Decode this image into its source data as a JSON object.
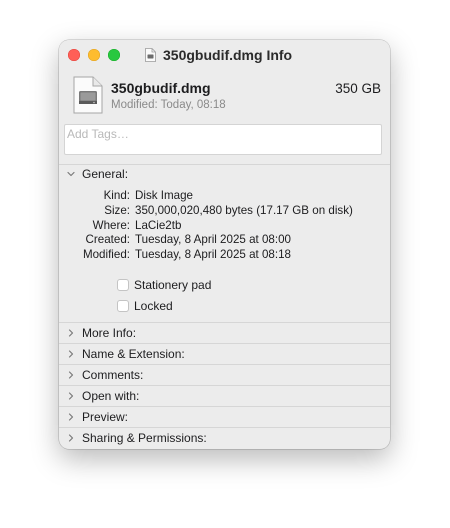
{
  "window": {
    "title": "350gbudif.dmg Info"
  },
  "summary": {
    "file_name": "350gbudif.dmg",
    "size": "350 GB",
    "modified": "Modified: Today, 08:18"
  },
  "tags": {
    "placeholder": "Add Tags…",
    "value": ""
  },
  "general": {
    "header": "General:",
    "rows": [
      {
        "key": "Kind:",
        "value": "Disk Image"
      },
      {
        "key": "Size:",
        "value": "350,000,020,480 bytes (17.17 GB on disk)"
      },
      {
        "key": "Where:",
        "value": "LaCie2tb"
      },
      {
        "key": "Created:",
        "value": "Tuesday, 8 April 2025 at 08:00"
      },
      {
        "key": "Modified:",
        "value": "Tuesday, 8 April 2025 at 08:18"
      }
    ],
    "stationery_label": "Stationery pad",
    "stationery_checked": false,
    "locked_label": "Locked",
    "locked_checked": false
  },
  "sections": [
    {
      "label": "More Info:",
      "expanded": false
    },
    {
      "label": "Name & Extension:",
      "expanded": false
    },
    {
      "label": "Comments:",
      "expanded": false
    },
    {
      "label": "Open with:",
      "expanded": false
    },
    {
      "label": "Preview:",
      "expanded": false
    },
    {
      "label": "Sharing & Permissions:",
      "expanded": false
    }
  ],
  "colors": {
    "close": "#ff5f57",
    "minimize": "#febc2e",
    "zoom": "#28c840",
    "window_bg": "#ececec"
  },
  "icons": {
    "title": "disk-image-document-icon",
    "file": "disk-image-document-icon",
    "expanded": "chevron-down-icon",
    "collapsed": "chevron-right-icon"
  }
}
